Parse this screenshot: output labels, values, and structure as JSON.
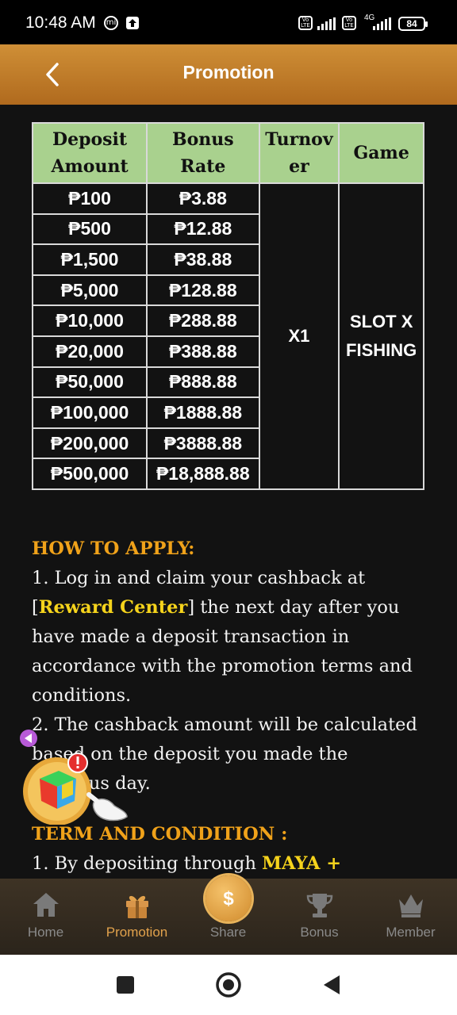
{
  "status_bar": {
    "time": "10:48 AM",
    "battery": "84",
    "network": "4G"
  },
  "header": {
    "title": "Promotion"
  },
  "table": {
    "headers": [
      "Deposit Amount",
      "Bonus Rate",
      "Turnover",
      "Game"
    ],
    "header_lines": {
      "deposit_1": "Deposit",
      "deposit_2": "Amount",
      "bonus": "Bonus Rate",
      "turnover_1": "Turnov",
      "turnover_2": "er",
      "game": "Game"
    },
    "rows": [
      {
        "deposit": "₱100",
        "bonus": "₱3.88"
      },
      {
        "deposit": "₱500",
        "bonus": "₱12.88"
      },
      {
        "deposit": "₱1,500",
        "bonus": "₱38.88"
      },
      {
        "deposit": "₱5,000",
        "bonus": "₱128.88"
      },
      {
        "deposit": "₱10,000",
        "bonus": "₱288.88"
      },
      {
        "deposit": "₱20,000",
        "bonus": "₱388.88"
      },
      {
        "deposit": "₱50,000",
        "bonus": "₱888.88"
      },
      {
        "deposit": "₱100,000",
        "bonus": "₱1888.88"
      },
      {
        "deposit": "₱200,000",
        "bonus": "₱3888.88"
      },
      {
        "deposit": "₱500,000",
        "bonus": "₱18,888.88"
      }
    ],
    "turnover": "X1",
    "game_1": "SLOT X",
    "game_2": "FISHING"
  },
  "how_to_apply": {
    "heading": "HOW TO APPLY:",
    "step1_pre": "1. Log in and claim your cashback at [",
    "step1_link": "Reward Center",
    "step1_post": "] the next day after you have made a deposit transaction in accordance with the promotion terms and conditions.",
    "step2": "2. The cashback amount will be calculated based on the deposit you made the previous day."
  },
  "terms": {
    "heading": "TERM AND CONDITION :",
    "item1_pre": "1. By depositing through ",
    "item1_highlight": "MAYA +"
  },
  "bottom_nav": {
    "items": [
      {
        "label": "Home",
        "icon": "home-icon"
      },
      {
        "label": "Promotion",
        "icon": "gift-icon"
      },
      {
        "label": "Share",
        "icon": "money-bag-icon"
      },
      {
        "label": "Bonus",
        "icon": "trophy-icon"
      },
      {
        "label": "Member",
        "icon": "crown-icon"
      }
    ],
    "active": "Promotion",
    "share_symbol": "$"
  },
  "colors": {
    "header": "#c0802a",
    "table_header": "#a9d18e",
    "heading": "#f0a21a",
    "highlight": "#f5d31c",
    "nav_active": "#e2a24c"
  }
}
